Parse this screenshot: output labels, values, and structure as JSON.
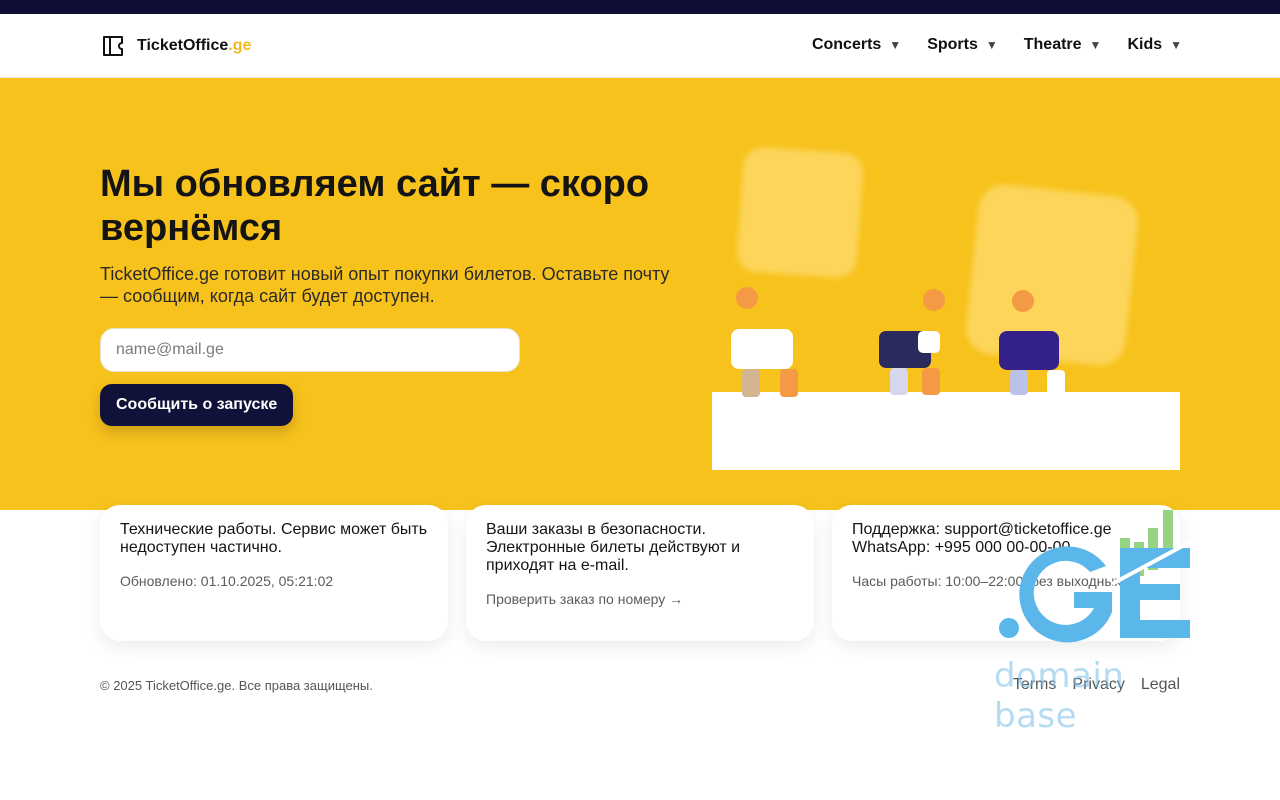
{
  "brand": {
    "name": "TicketOffice",
    "tld": ".ge"
  },
  "nav": [
    {
      "label": "Concerts"
    },
    {
      "label": "Sports"
    },
    {
      "label": "Theatre"
    },
    {
      "label": "Kids"
    }
  ],
  "hero": {
    "title": "Мы обновляем сайт — скоро вернёмся",
    "subtitle": "TicketOffice.ge готовит новый опыт покупки билетов. Оставьте почту — сообщим, когда сайт будет доступен.",
    "email_placeholder": "name@mail.ge",
    "cta_label": "Сообщить о запуске"
  },
  "cards": [
    {
      "main": "Технические работы. Сервис может быть недоступен частично.",
      "sub": "Обновлено: 01.10.2025, 05:21:02"
    },
    {
      "main": "Ваши заказы в безопасности. Электронные билеты действуют и приходят на e-mail.",
      "sub": "Проверить заказ по номеру →"
    },
    {
      "main_line1": "Поддержка: support@ticketoffice.ge",
      "main_line2": "WhatsApp: +995 000 00-00-00",
      "sub": "Часы работы: 10:00–22:00, без выходных"
    }
  ],
  "footer": {
    "copyright": "© 2025 TicketOffice.ge. Все права защищены.",
    "links": [
      {
        "label": "Terms"
      },
      {
        "label": "Privacy"
      },
      {
        "label": "Legal"
      }
    ]
  },
  "watermark": {
    "text": "domain base"
  },
  "colors": {
    "topbar": "#0e0d33",
    "accent": "#f8c21c",
    "cta": "#11123a",
    "tld": "#f3b91a"
  }
}
